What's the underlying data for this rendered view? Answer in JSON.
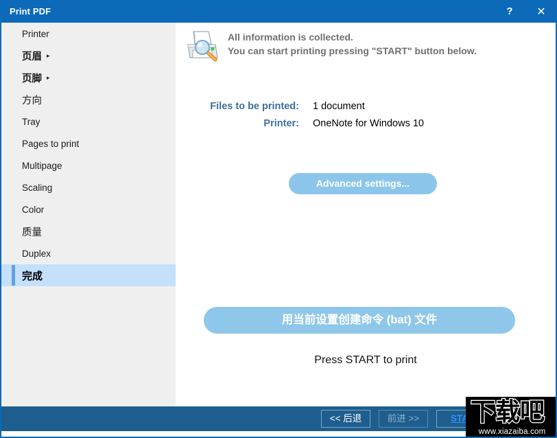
{
  "window": {
    "title": "Print PDF",
    "help_icon": "?",
    "close_icon": "✕",
    "accent_color": "#0c6ab8",
    "footer_color": "#1d5e8e"
  },
  "sidebar": {
    "items": [
      {
        "label": "Printer",
        "type": "latin",
        "arrow": "",
        "selected": false
      },
      {
        "label": "页眉",
        "type": "cjk-bold",
        "arrow": "▸",
        "selected": false
      },
      {
        "label": "页脚",
        "type": "cjk-bold",
        "arrow": "▸",
        "selected": false
      },
      {
        "label": "方向",
        "type": "cjk",
        "arrow": "",
        "selected": false
      },
      {
        "label": "Tray",
        "type": "latin",
        "arrow": "",
        "selected": false
      },
      {
        "label": "Pages to print",
        "type": "latin",
        "arrow": "",
        "selected": false
      },
      {
        "label": "Multipage",
        "type": "latin",
        "arrow": "",
        "selected": false
      },
      {
        "label": "Scaling",
        "type": "latin",
        "arrow": "",
        "selected": false
      },
      {
        "label": "Color",
        "type": "latin",
        "arrow": "",
        "selected": false
      },
      {
        "label": "质量",
        "type": "cjk",
        "arrow": "",
        "selected": false
      },
      {
        "label": "Duplex",
        "type": "latin",
        "arrow": "",
        "selected": false
      },
      {
        "label": "完成",
        "type": "cjk-bold",
        "arrow": "",
        "selected": true
      }
    ],
    "selected_bg": "#c4e0fb",
    "accent_bar": "#63a0e2"
  },
  "main": {
    "banner": {
      "icon": "printer-preview-icon",
      "line1": "All information is collected.",
      "line2": "You can start printing pressing \"START\" button below."
    },
    "summary": [
      {
        "label": "Files to be printed:",
        "value": "1 document"
      },
      {
        "label": "Printer:",
        "value": "OneNote for Windows 10"
      }
    ],
    "advanced_settings_label": "Advanced settings...",
    "create_bat_label": "用当前设置创建命令 (bat) 文件",
    "press_start_text": "Press START to print"
  },
  "footer": {
    "back_label": "<< 后退",
    "forward_label": "前进 >>",
    "start_label": "START"
  },
  "watermark": {
    "logo_text": "下载吧",
    "url": "www.xiazaiba.com"
  }
}
